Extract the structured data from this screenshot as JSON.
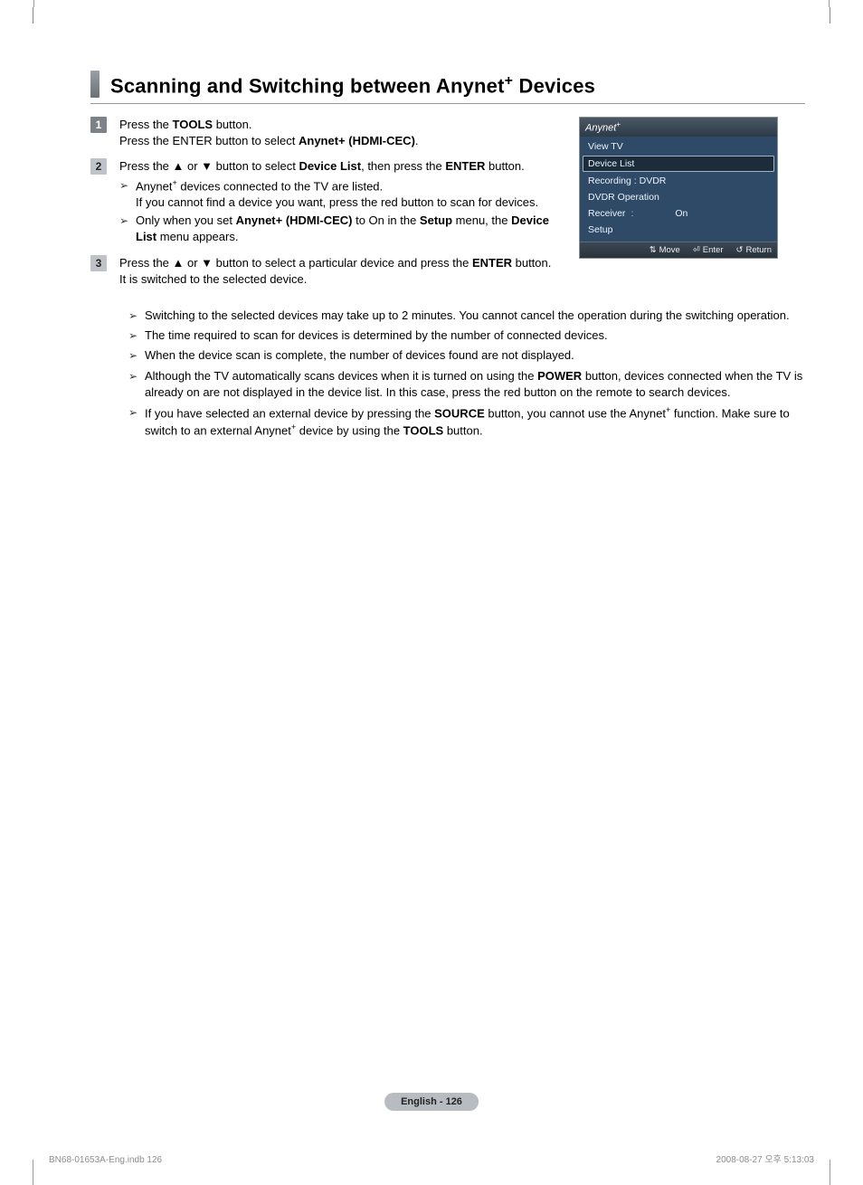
{
  "title_main": "Scanning and Switching between Anynet",
  "title_suffix": " Devices",
  "steps": [
    {
      "num": "1",
      "lines": [
        "Press the <b>TOOLS</b> button.",
        "Press the ENTER button to select <b>Anynet+ (HDMI-CEC)</b>."
      ]
    },
    {
      "num": "2",
      "lines": [
        "Press the ▲ or ▼ button to select <b>Device List</b>, then press the <b>ENTER</b> button."
      ],
      "subs": [
        "Anynet<sup>+</sup> devices connected to the TV are listed.<br>If you cannot find a device you want, press the red button to scan for devices.",
        "Only when you set <b>Anynet+ (HDMI-CEC)</b> to On in the <b>Setup</b> menu, the <b>Device List</b> menu appears."
      ]
    },
    {
      "num": "3",
      "lines": [
        "Press the ▲ or ▼ button to select a particular device and press the <b>ENTER</b> button. It is switched to the selected device."
      ]
    }
  ],
  "notes": [
    "Switching to the selected devices may take up to 2 minutes. You cannot cancel the operation during the switching operation.",
    "The time required to scan for devices is determined by the number of connected devices.",
    "When the device scan is complete, the number of devices found are not displayed.",
    "Although the TV automatically scans devices when it is turned on using the <b>POWER</b> button, devices connected when the TV is already on are not displayed in the device list. In this case, press the red button on the remote to search devices.",
    "If you have selected an external device by pressing the <b>SOURCE</b> button, you cannot use the Anynet<sup>+</sup> function. Make sure to switch to an external Anynet<sup>+</sup> device by using the <b>TOOLS</b> button."
  ],
  "osd": {
    "brand": "Anynet",
    "items": [
      {
        "label": "View TV"
      },
      {
        "label": "Device List",
        "selected": true
      },
      {
        "label": "Recording : DVDR"
      },
      {
        "label": "DVDR Operation"
      },
      {
        "label": "Receiver",
        "value": "On",
        "colon": ":"
      },
      {
        "label": "Setup"
      }
    ],
    "footer": {
      "move": "Move",
      "enter": "Enter",
      "ret": "Return"
    }
  },
  "footer_pill": "English - 126",
  "meta_left": "BN68-01653A-Eng.indb   126",
  "meta_right": "2008-08-27   오후 5:13:03"
}
